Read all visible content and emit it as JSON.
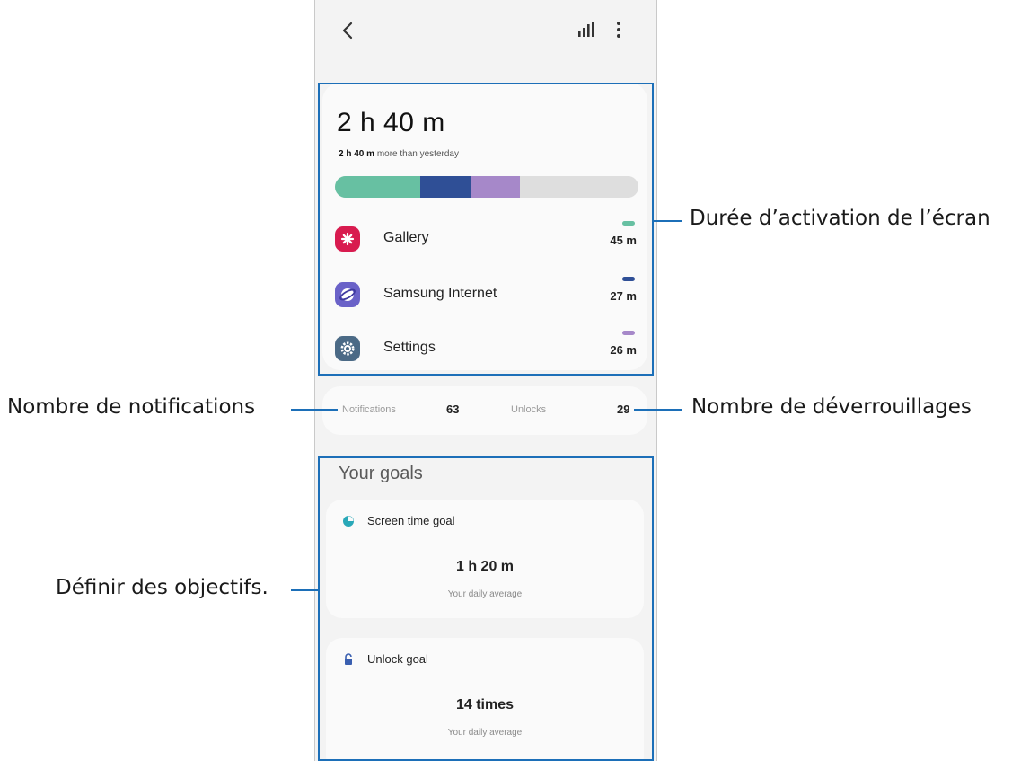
{
  "appbar": {
    "back_icon": "chevron-left-icon",
    "stats_icon": "bar-chart-icon",
    "more_icon": "more-vertical-icon"
  },
  "summary": {
    "total_time": "2 h 40 m",
    "compare_value": "2 h 40 m",
    "compare_text": "more than yesterday",
    "bar_colors": [
      "#67c0a2",
      "#2f4f96",
      "#a688c9",
      "#dedede"
    ],
    "bar_fractions": [
      0.28,
      0.17,
      0.16,
      0.39
    ],
    "apps": [
      {
        "name": "Gallery",
        "time": "45 m",
        "icon": "gallery-icon",
        "icon_color": "#d81b4f",
        "dash_color": "#67c0a2"
      },
      {
        "name": "Samsung Internet",
        "time": "27 m",
        "icon": "samsung-internet-icon",
        "icon_color": "#6a62c8",
        "dash_color": "#2f4f96"
      },
      {
        "name": "Settings",
        "time": "26 m",
        "icon": "settings-gear-icon",
        "icon_color": "#4b6a86",
        "dash_color": "#a688c9"
      }
    ]
  },
  "counts": {
    "notifications_label": "Notifications",
    "notifications_value": "63",
    "unlocks_label": "Unlocks",
    "unlocks_value": "29"
  },
  "goals": {
    "title": "Your goals",
    "screen_time": {
      "label": "Screen time goal",
      "value": "1 h 20 m",
      "sub": "Your daily average",
      "icon": "pie-clock-icon",
      "icon_color": "#29a8b8"
    },
    "unlock": {
      "label": "Unlock goal",
      "value": "14 times",
      "sub": "Your daily average",
      "icon": "unlock-icon",
      "icon_color": "#3a5fb0"
    }
  },
  "callouts": {
    "screen_time": "Durée d’activation de l’écran",
    "notifications": "Nombre de notifications",
    "unlocks": "Nombre de déverrouillages",
    "goals": "Définir des objectifs."
  }
}
